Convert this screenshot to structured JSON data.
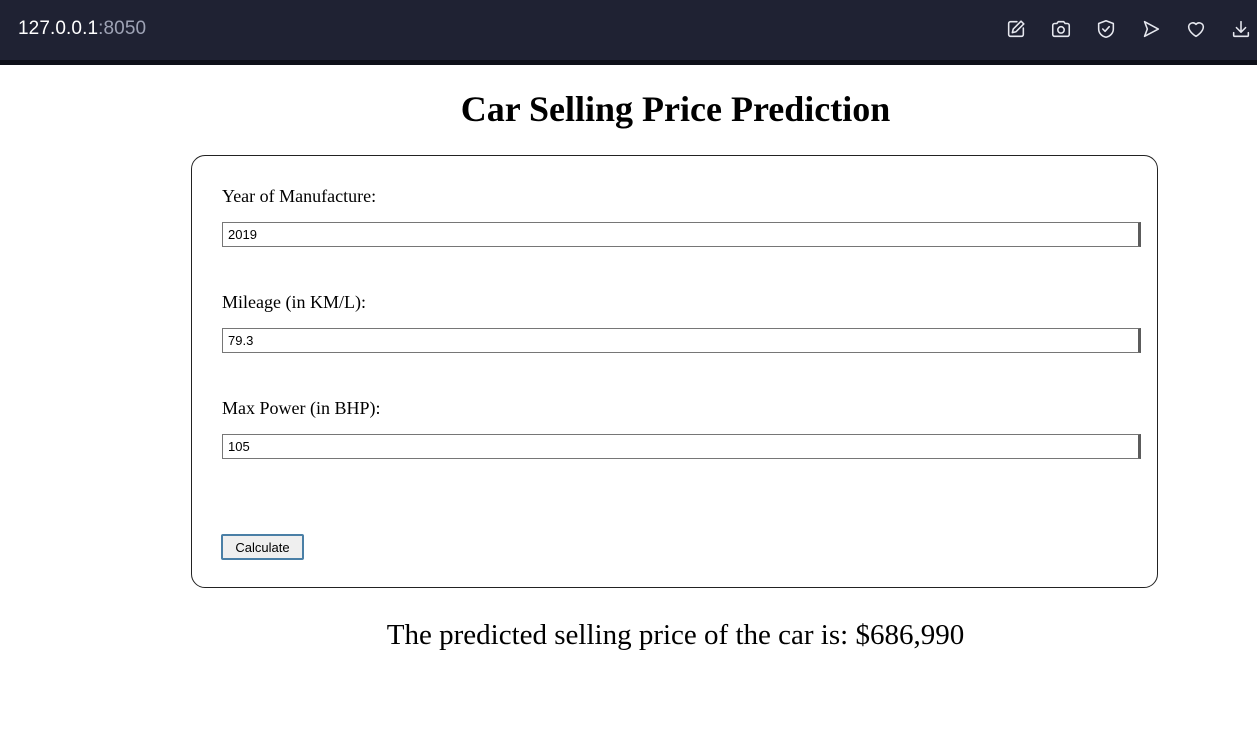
{
  "browser": {
    "url_host": "127.0.0.1",
    "url_port": ":8050",
    "toolbar_icons": [
      "edit-icon",
      "camera-icon",
      "shield-check-icon",
      "send-icon",
      "heart-icon",
      "download-icon"
    ],
    "bar_color": "#1f2233"
  },
  "page": {
    "title": "Car Selling Price Prediction",
    "form": {
      "year_label": "Year of Manufacture:",
      "year_value": "2019",
      "mileage_label": "Mileage (in KM/L):",
      "mileage_value": "79.3",
      "power_label": "Max Power (in BHP):",
      "power_value": "105",
      "calculate_label": "Calculate"
    },
    "result": "The predicted selling price of the car is: $686,990"
  }
}
